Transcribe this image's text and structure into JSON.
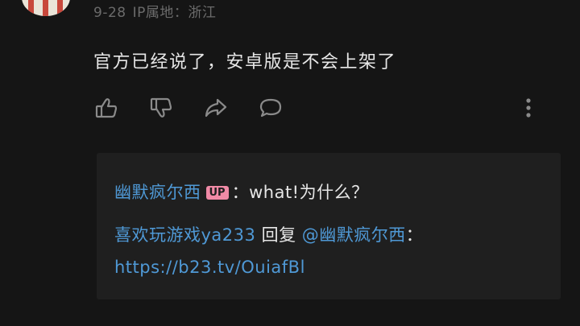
{
  "comment": {
    "date": "9-28",
    "location": "IP属地：浙江",
    "text": "官方已经说了，安卓版是不会上架了"
  },
  "actions": {
    "icons": [
      "thumbs-up-icon",
      "thumbs-down-icon",
      "share-icon",
      "comment-bubble-icon",
      "more-vertical-icon"
    ]
  },
  "replies": [
    {
      "user": "幽默疯尔西",
      "badge": "UP",
      "text": "：what!为什么？"
    },
    {
      "user": "喜欢玩游戏ya233",
      "reply_word": "回复",
      "mention": "@幽默疯尔西",
      "colon": "：",
      "link": "https://b23.tv/OuiafBl"
    }
  ],
  "colors": {
    "background": "#151515",
    "text": "#e6e6e6",
    "meta": "#6b6b6b",
    "link": "#4f99d6",
    "badge": "#f08aa6",
    "reply_box": "#1f1f1f"
  }
}
